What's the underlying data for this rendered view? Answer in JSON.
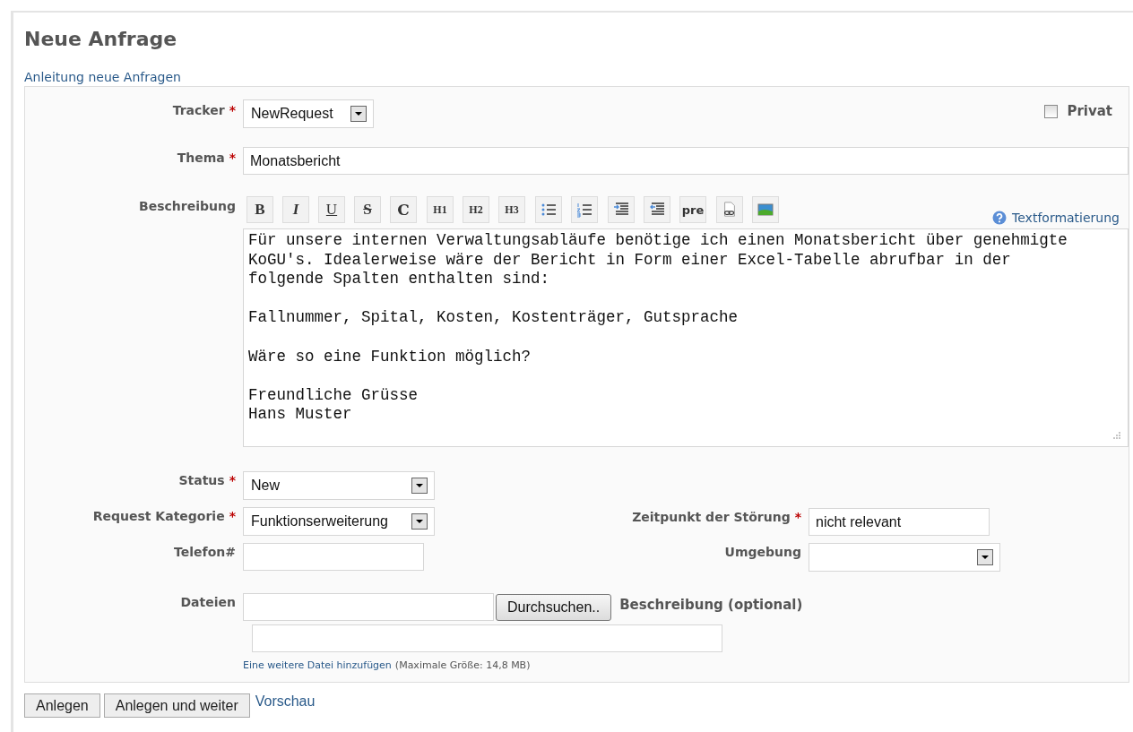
{
  "page": {
    "title": "Neue Anfrage",
    "help_link": "Anleitung neue Anfragen"
  },
  "required_mark": "*",
  "tracker": {
    "label": "Tracker",
    "required": true,
    "value": "NewRequest"
  },
  "private": {
    "label": "Privat",
    "checked": false
  },
  "subject": {
    "label": "Thema",
    "required": true,
    "value": "Monatsbericht"
  },
  "description": {
    "label": "Beschreibung",
    "help_link": "Textformatierung",
    "toolbar": [
      [
        {
          "kind": "bold",
          "text": "B"
        },
        {
          "kind": "italic",
          "text": "I"
        },
        {
          "kind": "underline",
          "text": "U"
        },
        {
          "kind": "strike",
          "text": "S"
        },
        {
          "kind": "code",
          "text": "C"
        }
      ],
      [
        {
          "kind": "heading",
          "text": "H1"
        },
        {
          "kind": "heading",
          "text": "H2"
        },
        {
          "kind": "heading",
          "text": "H3"
        }
      ],
      [
        {
          "kind": "bullets"
        },
        {
          "kind": "numbers"
        }
      ],
      [
        {
          "kind": "indent"
        },
        {
          "kind": "outdent"
        },
        {
          "kind": "pre",
          "text": "pre"
        }
      ],
      [
        {
          "kind": "link"
        },
        {
          "kind": "image"
        }
      ]
    ],
    "value": "Für unsere internen Verwaltungsabläufe benötige ich einen Monatsbericht über genehmigte\nKoGU's. Idealerweise wäre der Bericht in Form einer Excel-Tabelle abrufbar in der\nfolgende Spalten enthalten sind:\n\nFallnummer, Spital, Kosten, Kostenträger, Gutsprache\n\nWäre so eine Funktion möglich?\n\nFreundliche Grüsse\nHans Muster"
  },
  "fields_left": [
    {
      "label": "Status",
      "required": true,
      "kind": "select",
      "value": "New"
    },
    {
      "label": "Request Kategorie",
      "required": true,
      "kind": "select",
      "value": "Funktionserweiterung"
    },
    {
      "label": "Telefon#",
      "required": false,
      "kind": "input"
    }
  ],
  "fields_right": [
    {
      "label": "Zeitpunkt der Störung",
      "required": true,
      "kind": "input",
      "value": "nicht relevant"
    },
    {
      "label": "Umgebung",
      "required": false,
      "kind": "select"
    }
  ],
  "files": {
    "label": "Dateien",
    "browse_button": "Durchsuchen..",
    "description_label": "Beschreibung (optional)",
    "add_link": "Eine weitere Datei hinzufügen",
    "max_size_note": "(Maximale Größe: 14,8 MB)"
  },
  "buttons": [
    {
      "kind": "button",
      "label": "Anlegen"
    },
    {
      "kind": "button",
      "label": "Anlegen und weiter"
    },
    {
      "kind": "link",
      "label": "Vorschau"
    }
  ]
}
